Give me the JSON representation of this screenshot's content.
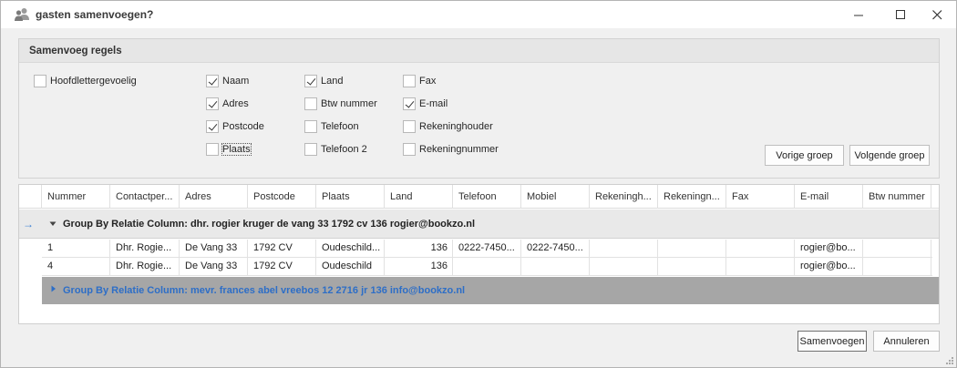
{
  "window": {
    "title": "gasten samenvoegen?",
    "controls": {
      "minimize": "–",
      "maximize": "☐",
      "close": "✕"
    }
  },
  "rules": {
    "heading": "Samenvoeg regels",
    "checkboxes": [
      {
        "label": "Hoofdlettergevoelig",
        "checked": false
      },
      {
        "label": "Naam",
        "checked": true
      },
      {
        "label": "Adres",
        "checked": true
      },
      {
        "label": "Postcode",
        "checked": true
      },
      {
        "label": "Plaats",
        "checked": false
      },
      {
        "label": "Land",
        "checked": true
      },
      {
        "label": "Btw nummer",
        "checked": false
      },
      {
        "label": "Telefoon",
        "checked": false
      },
      {
        "label": "Telefoon 2",
        "checked": false
      },
      {
        "label": "Fax",
        "checked": false
      },
      {
        "label": "E-mail",
        "checked": true
      },
      {
        "label": "Rekeninghouder",
        "checked": false
      },
      {
        "label": "Rekeningnummer",
        "checked": false
      }
    ],
    "prev_group": "Vorige groep",
    "next_group": "Volgende groep"
  },
  "grid": {
    "columns": [
      "Nummer",
      "Contactper...",
      "Adres",
      "Postcode",
      "Plaats",
      "Land",
      "Telefoon",
      "Mobiel",
      "Rekeningh...",
      "Rekeningn...",
      "Fax",
      "E-mail",
      "Btw nummer"
    ],
    "group1": {
      "label": "Group By Relatie Column: dhr. rogier kruger de vang 33 1792 cv 136 rogier@bookzo.nl",
      "rows": [
        [
          "1",
          "Dhr. Rogie...",
          "De Vang 33",
          "1792 CV",
          "Oudeschild...",
          "136",
          "0222-7450...",
          "0222-7450...",
          "",
          "",
          "",
          "rogier@bo...",
          ""
        ],
        [
          "4",
          "Dhr. Rogie...",
          "De Vang 33",
          "1792 CV",
          "Oudeschild",
          "136",
          "",
          "",
          "",
          "",
          "",
          "rogier@bo...",
          ""
        ]
      ]
    },
    "group2": {
      "label": "Group By Relatie Column: mevr. frances abel vreebos 12 2716 jr 136 info@bookzo.nl"
    },
    "row_indicator": "→"
  },
  "footer": {
    "merge": "Samenvoegen",
    "cancel": "Annuleren"
  },
  "colors": {
    "group_text_blue": "#2d6ec7",
    "indicator_blue": "#3b7fd4"
  }
}
